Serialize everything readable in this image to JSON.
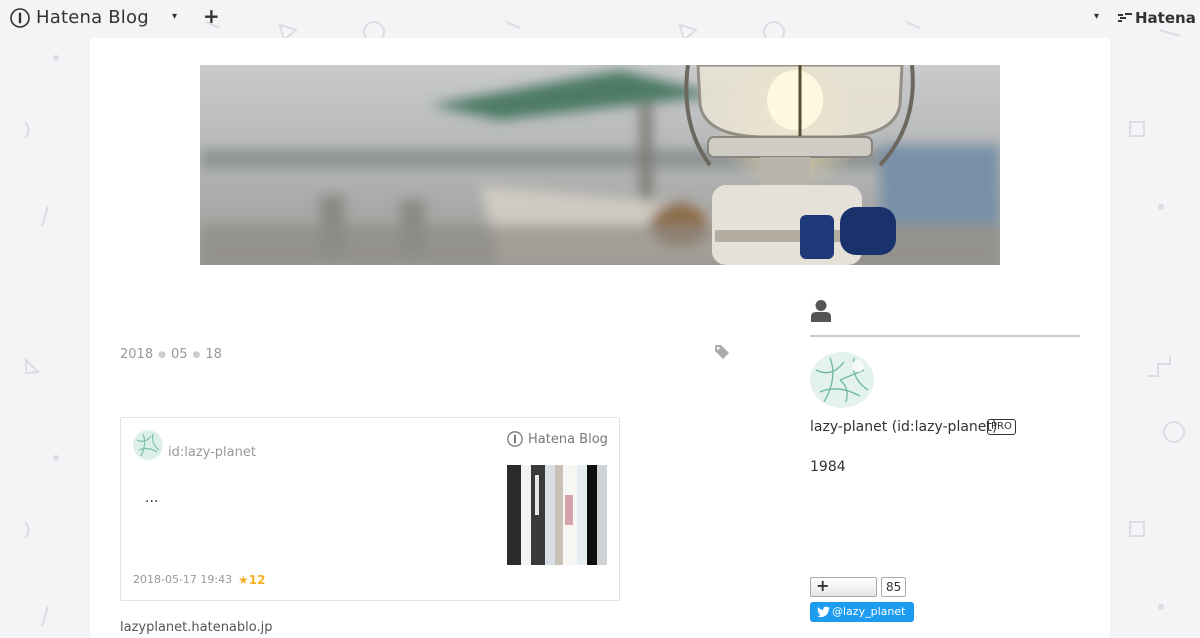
{
  "global_header": {
    "logo_text": "Hatena Blog",
    "hatena_text": "Hatena"
  },
  "entry": {
    "date": {
      "year": "2018",
      "month": "05",
      "day": "18"
    },
    "embed_card": {
      "username": "id:lazy-planet",
      "brand": "Hatena Blog",
      "excerpt": "...",
      "timestamp": "2018-05-17 19:43",
      "stars": "12"
    },
    "body_text": "lazyplanet.hatenablo.jp"
  },
  "sidebar": {
    "profile": {
      "name": "lazy-planet (id:lazy-planet)",
      "badge": "PRO",
      "year": "1984"
    },
    "follow_count": "85",
    "twitter_label": "@lazy_planet"
  },
  "colors": {
    "background": "#f4f4f6",
    "panel": "#ffffff",
    "star": "#f4b128",
    "twitter": "#1d9bf0"
  }
}
